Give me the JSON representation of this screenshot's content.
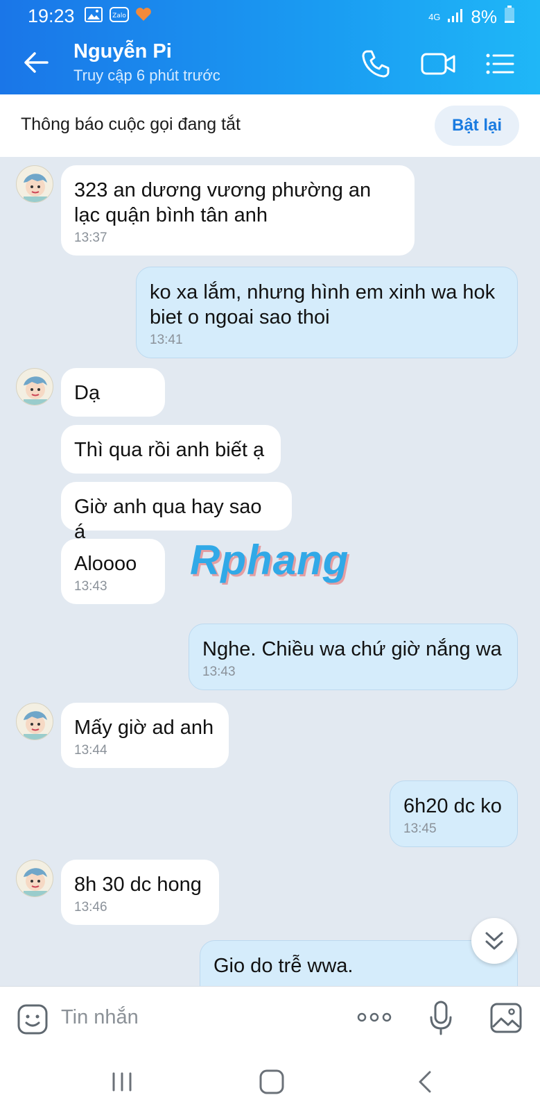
{
  "status_bar": {
    "time": "19:23",
    "network": "4G",
    "battery": "8%"
  },
  "header": {
    "contact_name": "Nguyễn Pi",
    "last_seen": "Truy cập 6 phút trước"
  },
  "notice": {
    "text": "Thông báo cuộc gọi đang tắt",
    "button": "Bật lại"
  },
  "messages": [
    {
      "side": "in",
      "text": "323 an dương vương phường an lạc quận bình tân anh",
      "time": "13:37"
    },
    {
      "side": "out",
      "text": "ko xa lắm, nhưng hình em xinh wa hok biet o ngoai sao thoi",
      "time": "13:41"
    },
    {
      "side": "in",
      "text": "Dạ",
      "time": ""
    },
    {
      "side": "in",
      "text": "Thì qua rồi anh biết ạ",
      "time": ""
    },
    {
      "side": "in",
      "text": "Giờ anh qua hay sao á",
      "time": ""
    },
    {
      "side": "in",
      "text": "Aloooo",
      "time": "13:43"
    },
    {
      "side": "out",
      "text": "Nghe. Chiều wa chứ giờ nắng wa",
      "time": "13:43"
    },
    {
      "side": "in",
      "text": "Mấy giờ ad anh",
      "time": "13:44"
    },
    {
      "side": "out",
      "text": "6h20 dc ko",
      "time": "13:45"
    },
    {
      "side": "in",
      "text": "8h 30 dc hong",
      "time": "13:46"
    },
    {
      "side": "out",
      "text": "Gio do trễ wwa.",
      "time": ""
    }
  ],
  "watermark": "Rphang",
  "input": {
    "placeholder": "Tin nhắn"
  },
  "icons": {
    "header": [
      "back-arrow-icon",
      "phone-call-icon",
      "video-call-icon",
      "menu-list-icon"
    ],
    "input": [
      "emoji-icon",
      "more-icon",
      "microphone-icon",
      "image-icon"
    ],
    "nav": [
      "recent-apps-icon",
      "home-icon",
      "back-icon"
    ]
  },
  "colors": {
    "header_start": "#1a76e8",
    "header_end": "#1fb7f7",
    "accent": "#1a7be0",
    "outgoing_bubble": "#d5ecfb",
    "chat_bg": "#e2e9f1"
  }
}
